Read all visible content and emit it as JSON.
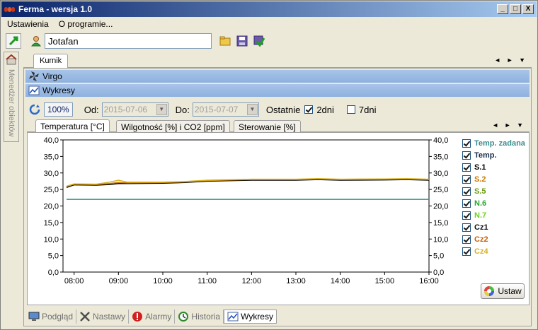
{
  "window": {
    "title": "Ferma - wersja 1.0",
    "min": "_",
    "max": "□",
    "close": "X"
  },
  "menu": {
    "items": [
      "Ustawienia",
      "O programie..."
    ]
  },
  "toolbar": {
    "user": "Jotafan"
  },
  "sidebar": {
    "label": "Menedżer obiektów"
  },
  "outer_tab": "Kurnik",
  "headers": {
    "group": "Virgo",
    "section": "Wykresy"
  },
  "controls": {
    "zoom": "100%",
    "from_label": "Od:",
    "from_value": "2015-07-06",
    "to_label": "Do:",
    "to_value": "2015-07-07",
    "last_label": "Ostatnie",
    "opt_2dni": {
      "label": "2dni",
      "checked": true
    },
    "opt_7dni": {
      "label": "7dni",
      "checked": false
    }
  },
  "chart_tabs": [
    "Temperatura [°C]",
    "Wilgotność [%] i CO2 [ppm]",
    "Sterowanie [%]"
  ],
  "legend": [
    {
      "label": "Temp. zadana",
      "color": "#3a8c8c",
      "checked": true
    },
    {
      "label": "Temp.",
      "color": "#1a2e4a",
      "checked": true
    },
    {
      "label": "S.1",
      "color": "#000000",
      "checked": true
    },
    {
      "label": "S.2",
      "color": "#c87800",
      "checked": true
    },
    {
      "label": "S.5",
      "color": "#6a9a10",
      "checked": true
    },
    {
      "label": "N.6",
      "color": "#2aa82a",
      "checked": true
    },
    {
      "label": "N.7",
      "color": "#70d020",
      "checked": true
    },
    {
      "label": "Cz1",
      "color": "#101010",
      "checked": true
    },
    {
      "label": "Cz2",
      "color": "#c86000",
      "checked": true
    },
    {
      "label": "Cz4",
      "color": "#d8b020",
      "checked": true
    }
  ],
  "apply_button": "Ustaw",
  "bottom_tabs": [
    "Podgląd",
    "Nastawy",
    "Alarmy",
    "Historia",
    "Wykresy"
  ],
  "chart_data": {
    "type": "line",
    "ylim": [
      0,
      40
    ],
    "yticks": [
      "0,0",
      "5,0",
      "10,0",
      "15,0",
      "20,0",
      "25,0",
      "30,0",
      "35,0",
      "40,0"
    ],
    "xticks": [
      "08:00",
      "09:00",
      "10:00",
      "11:00",
      "12:00",
      "13:00",
      "14:00",
      "15:00",
      "16:00"
    ],
    "x": [
      7.83,
      8.0,
      8.5,
      8.8,
      9.0,
      9.2,
      10.0,
      10.5,
      11.0,
      12.0,
      13.0,
      13.5,
      14.0,
      15.0,
      15.5,
      16.0
    ],
    "series": [
      {
        "name": "Temp. zadana",
        "color": "#3a8c8c",
        "values": [
          22.0,
          22.0,
          22.0,
          22.0,
          22.0,
          22.0,
          22.0,
          22.0,
          22.0,
          22.0,
          22.0,
          22.0,
          22.0,
          22.0,
          22.0,
          22.0
        ]
      },
      {
        "name": "S.1",
        "color": "#000000",
        "values": [
          25.6,
          26.4,
          26.3,
          26.5,
          26.8,
          26.8,
          26.9,
          27.1,
          27.5,
          27.8,
          27.8,
          28.0,
          27.8,
          27.9,
          28.0,
          27.8
        ]
      },
      {
        "name": "S.2",
        "color": "#c87800",
        "values": [
          25.9,
          26.6,
          26.5,
          26.8,
          27.1,
          27.0,
          27.1,
          27.3,
          27.7,
          28.0,
          28.0,
          28.2,
          28.0,
          28.1,
          28.2,
          28.0
        ]
      },
      {
        "name": "Cz4",
        "color": "#d8b020",
        "values": [
          26.0,
          26.7,
          26.6,
          27.2,
          27.8,
          27.2,
          27.2,
          27.4,
          27.8,
          28.1,
          28.1,
          28.3,
          28.1,
          28.2,
          28.3,
          28.1
        ]
      }
    ]
  }
}
